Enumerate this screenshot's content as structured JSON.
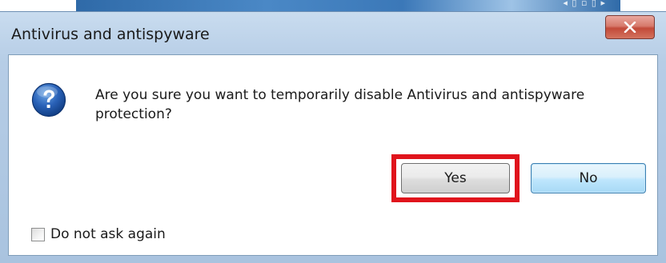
{
  "window": {
    "title": "Antivirus and antispyware"
  },
  "dialog": {
    "message": "Are you sure you want to temporarily disable Antivirus and antispyware protection?",
    "icon": "question-icon",
    "yes_label": "Yes",
    "no_label": "No",
    "checkbox_label": "Do not ask again",
    "checkbox_checked": false
  },
  "colors": {
    "highlight": "#e0141c",
    "close_button": "#c24a39",
    "default_button_border": "#3c7fb1"
  }
}
